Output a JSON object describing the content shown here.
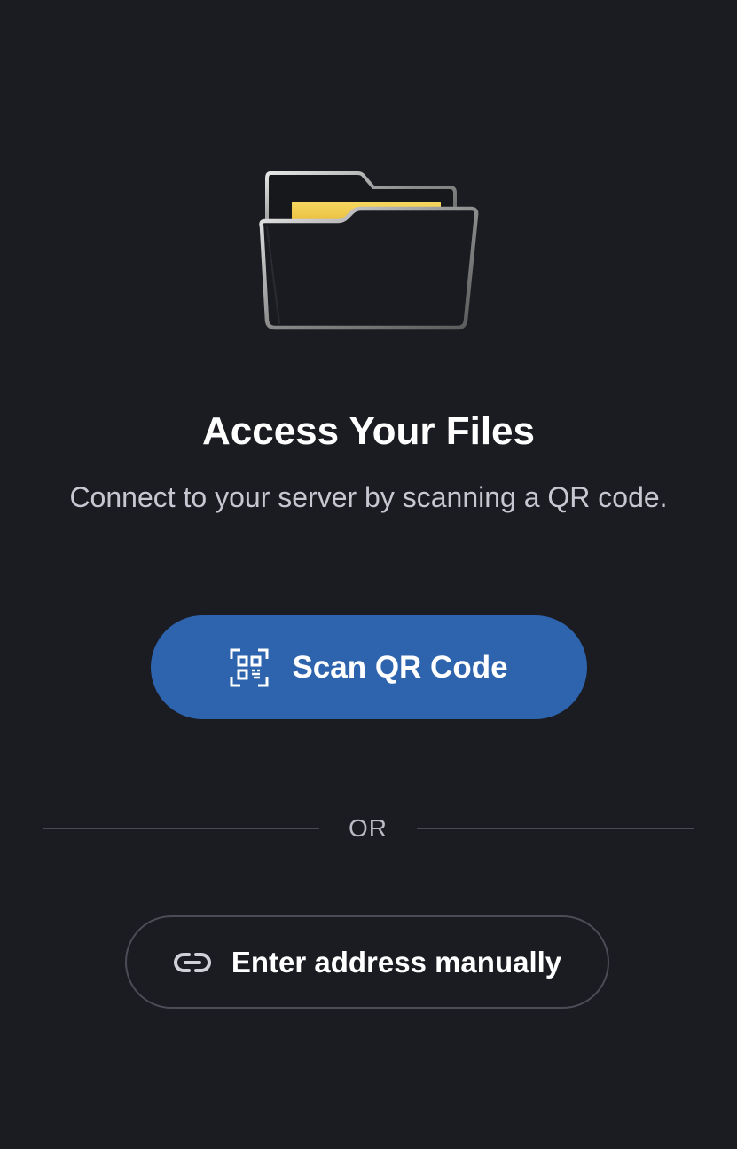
{
  "hero": {
    "icon": "folder-open-icon",
    "title": "Access Your Files",
    "subtitle": "Connect to your server by scanning a QR code."
  },
  "actions": {
    "scan": {
      "label": "Scan QR Code",
      "icon": "qr-code-scanner-icon",
      "color": "#2e63ae"
    },
    "separator": "OR",
    "manual": {
      "label": "Enter address manually",
      "icon": "link-icon"
    }
  },
  "colors": {
    "background": "#1b1c21",
    "folder_paper": "#f2c94c"
  }
}
